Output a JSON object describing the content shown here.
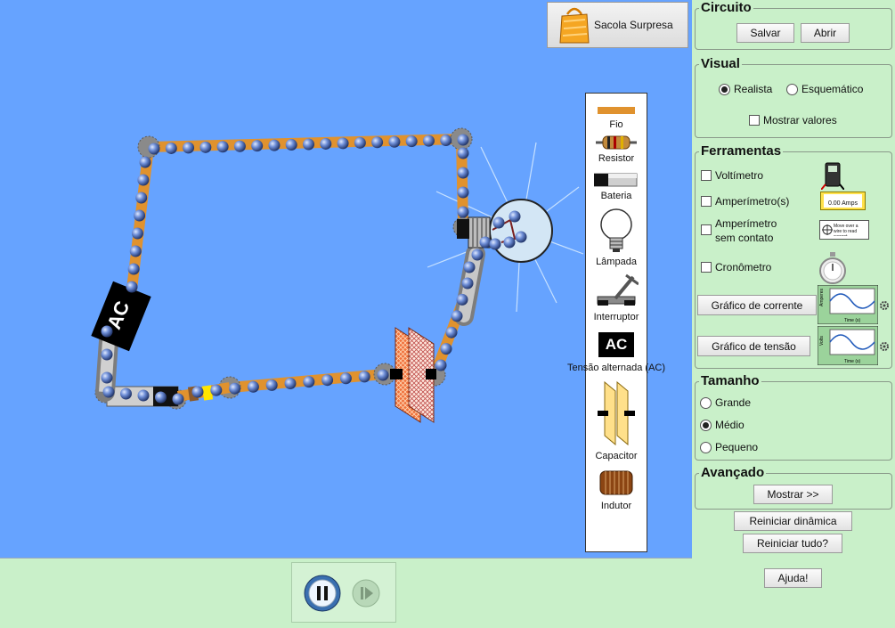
{
  "surprise_bag": {
    "label": "Sacola Surpresa"
  },
  "toolbox": {
    "items": [
      {
        "label": "Fio"
      },
      {
        "label": "Resistor"
      },
      {
        "label": "Bateria"
      },
      {
        "label": "Lâmpada"
      },
      {
        "label": "Interruptor"
      },
      {
        "label": "Tensão alternada (AC)",
        "icon_text": "AC"
      },
      {
        "label": "Capacitor"
      },
      {
        "label": "Indutor"
      }
    ]
  },
  "circuit": {
    "ac_source_label": "AC"
  },
  "panels": {
    "circuito": {
      "title": "Circuito",
      "save": "Salvar",
      "open": "Abrir"
    },
    "visual": {
      "title": "Visual",
      "realistic": "Realista",
      "schematic": "Esquemático",
      "show_values": "Mostrar valores",
      "selected": "Realista"
    },
    "ferramentas": {
      "title": "Ferramentas",
      "voltmeter": "Voltímetro",
      "ammeter": "Amperímetro(s)",
      "ammeter_reading": "0.00 Amps",
      "noncontact_ammeter_l1": "Amperímetro",
      "noncontact_ammeter_l2": "sem contato",
      "noncontact_hint": "Move over a wire to read current",
      "stopwatch": "Cronômetro",
      "current_chart": "Gráfico de corrente",
      "voltage_chart": "Gráfico de tensão",
      "chart_current_axis": "Amperes",
      "chart_voltage_axis": "Volts",
      "chart_time_axis": "Time (s)"
    },
    "tamanho": {
      "title": "Tamanho",
      "large": "Grande",
      "medium": "Médio",
      "small": "Pequeno",
      "selected": "Médio"
    },
    "avancado": {
      "title": "Avançado",
      "show": "Mostrar >>"
    }
  },
  "actions": {
    "reset_dynamics": "Reiniciar dinâmica",
    "reset_all": "Reiniciar tudo?",
    "help": "Ajuda!"
  },
  "colors": {
    "canvas": "#66a3ff",
    "panel": "#c9f0c9",
    "wire": "#e0922e",
    "electron": "#5577cc"
  }
}
